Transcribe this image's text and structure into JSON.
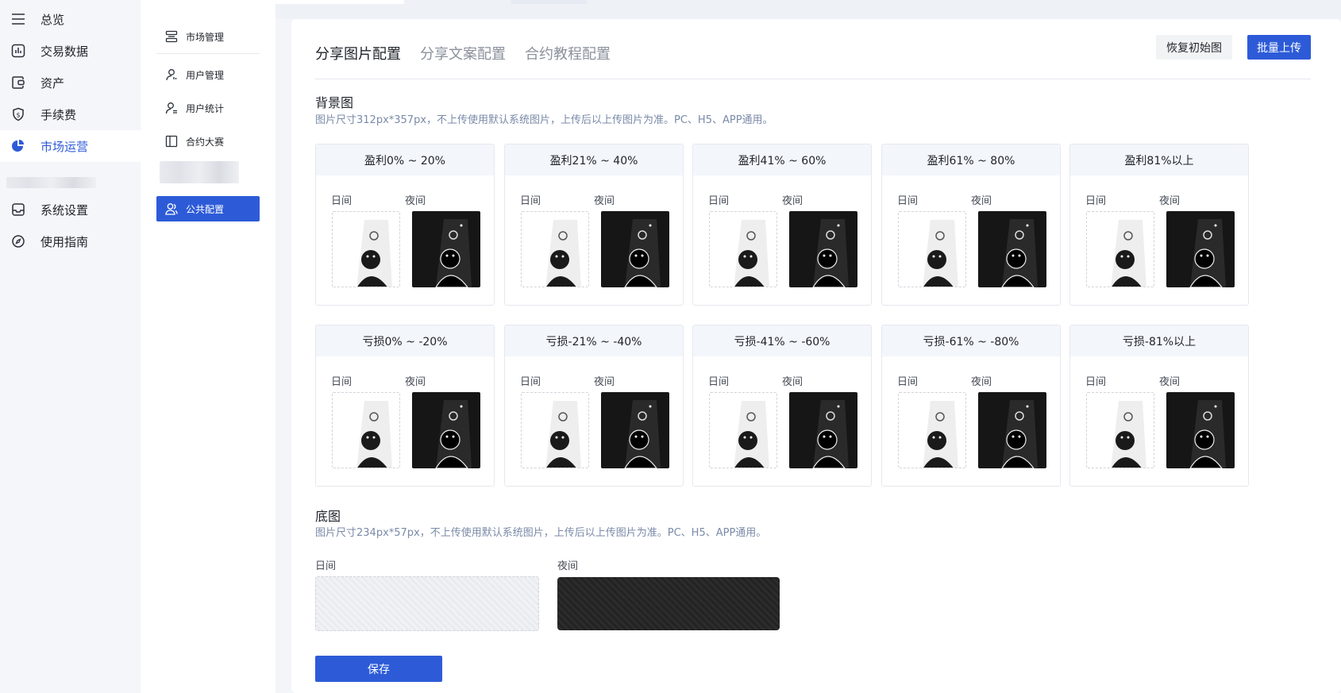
{
  "sidebar": {
    "items": [
      {
        "label": "总览",
        "icon": "menu-icon"
      },
      {
        "label": "交易数据",
        "icon": "chart-icon"
      },
      {
        "label": "资产",
        "icon": "wallet-icon"
      },
      {
        "label": "手续费",
        "icon": "fee-shield-icon"
      },
      {
        "label": "市场运营",
        "icon": "pie-icon",
        "active": true
      },
      {
        "label": "系统设置",
        "icon": "inbox-icon"
      },
      {
        "label": "使用指南",
        "icon": "compass-icon"
      }
    ]
  },
  "subnav": {
    "items": [
      {
        "label": "市场管理",
        "icon": "list-icon"
      },
      {
        "label": "用户管理",
        "icon": "user-icon"
      },
      {
        "label": "用户统计",
        "icon": "user-stats-icon"
      },
      {
        "label": "合约大赛",
        "icon": "book-icon"
      },
      {
        "label": "公共配置",
        "icon": "users-icon",
        "active": true
      }
    ]
  },
  "main": {
    "tabs": [
      "分享图片配置",
      "分享文案配置",
      "合约教程配置"
    ],
    "reset_label": "恢复初始图",
    "upload_label": "批量上传",
    "background": {
      "title": "背景图",
      "desc": "图片尺寸312px*357px，不上传使用默认系统图片，上传后以上传图片为准。PC、H5、APP通用。"
    },
    "day_label": "日间",
    "night_label": "夜间",
    "profit_tiles": [
      "盈利0% ~ 20%",
      "盈利21% ~ 40%",
      "盈利41% ~ 60%",
      "盈利61% ~ 80%",
      "盈利81%以上"
    ],
    "loss_tiles": [
      "亏损0% ~ -20%",
      "亏损-21% ~ -40%",
      "亏损-41% ~ -60%",
      "亏损-61% ~ -80%",
      "亏损-81%以上"
    ],
    "base": {
      "title": "底图",
      "desc": "图片尺寸234px*57px，不上传使用默认系统图片，上传后以上传图片为准。PC、H5、APP通用。"
    },
    "save_label": "保存"
  },
  "colors": {
    "accent": "#2d5bd8",
    "night_bg": "#161616"
  }
}
